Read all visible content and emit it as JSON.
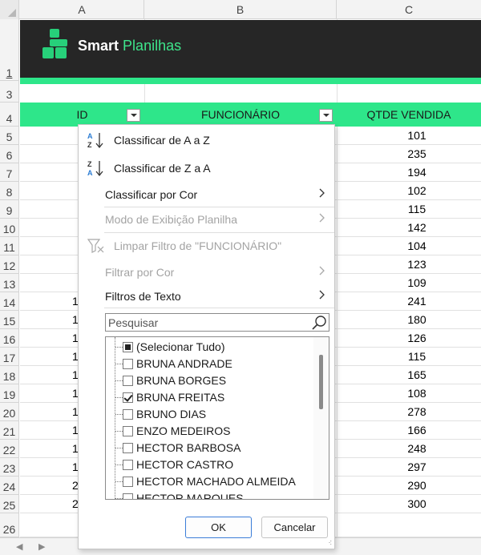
{
  "columns": [
    "A",
    "B",
    "C"
  ],
  "rows": [
    "1",
    "3",
    "4",
    "5",
    "6",
    "7",
    "8",
    "9",
    "10",
    "11",
    "12",
    "13",
    "14",
    "15",
    "16",
    "17",
    "18",
    "19",
    "20",
    "21",
    "22",
    "23",
    "24",
    "25",
    "26"
  ],
  "brand": {
    "name_bold": "Smart",
    "name_light": "Planilhas"
  },
  "table_header": {
    "id": "ID",
    "funcionario": "FUNCIONÁRIO",
    "qtde": "QTDE VENDIDA"
  },
  "qtde_values": [
    "101",
    "235",
    "194",
    "102",
    "115",
    "142",
    "104",
    "123",
    "109",
    "241",
    "180",
    "126",
    "115",
    "165",
    "108",
    "278",
    "166",
    "248",
    "297",
    "290",
    "300"
  ],
  "id_fragments": [
    "1",
    "1",
    "1",
    "1",
    "1",
    "1",
    "1",
    "1",
    "1",
    "1",
    "2",
    "2"
  ],
  "menu": {
    "sort_az": "Classificar de A a Z",
    "sort_za": "Classificar de Z a A",
    "sort_color": "Classificar por Cor",
    "sheet_view": "Modo de Exibição Planilha",
    "clear_filter": "Limpar Filtro de \"FUNCIONÁRIO\"",
    "filter_color": "Filtrar por Cor",
    "text_filters": "Filtros de Texto"
  },
  "search": {
    "placeholder": "Pesquisar"
  },
  "filter_list": [
    {
      "label": "(Selecionar Tudo)",
      "state": "indeterminate"
    },
    {
      "label": "BRUNA ANDRADE",
      "state": "unchecked"
    },
    {
      "label": "BRUNA BORGES",
      "state": "unchecked"
    },
    {
      "label": "BRUNA FREITAS",
      "state": "checked"
    },
    {
      "label": "BRUNO DIAS",
      "state": "unchecked"
    },
    {
      "label": "ENZO MEDEIROS",
      "state": "unchecked"
    },
    {
      "label": "HECTOR BARBOSA",
      "state": "unchecked"
    },
    {
      "label": "HECTOR CASTRO",
      "state": "unchecked"
    },
    {
      "label": "HECTOR MACHADO ALMEIDA",
      "state": "unchecked"
    },
    {
      "label": "HECTOR MARQUES",
      "state": "unchecked"
    }
  ],
  "buttons": {
    "ok": "OK",
    "cancel": "Cancelar"
  },
  "colors": {
    "accent_green": "#2ee68a",
    "banner_dark": "#262626"
  }
}
